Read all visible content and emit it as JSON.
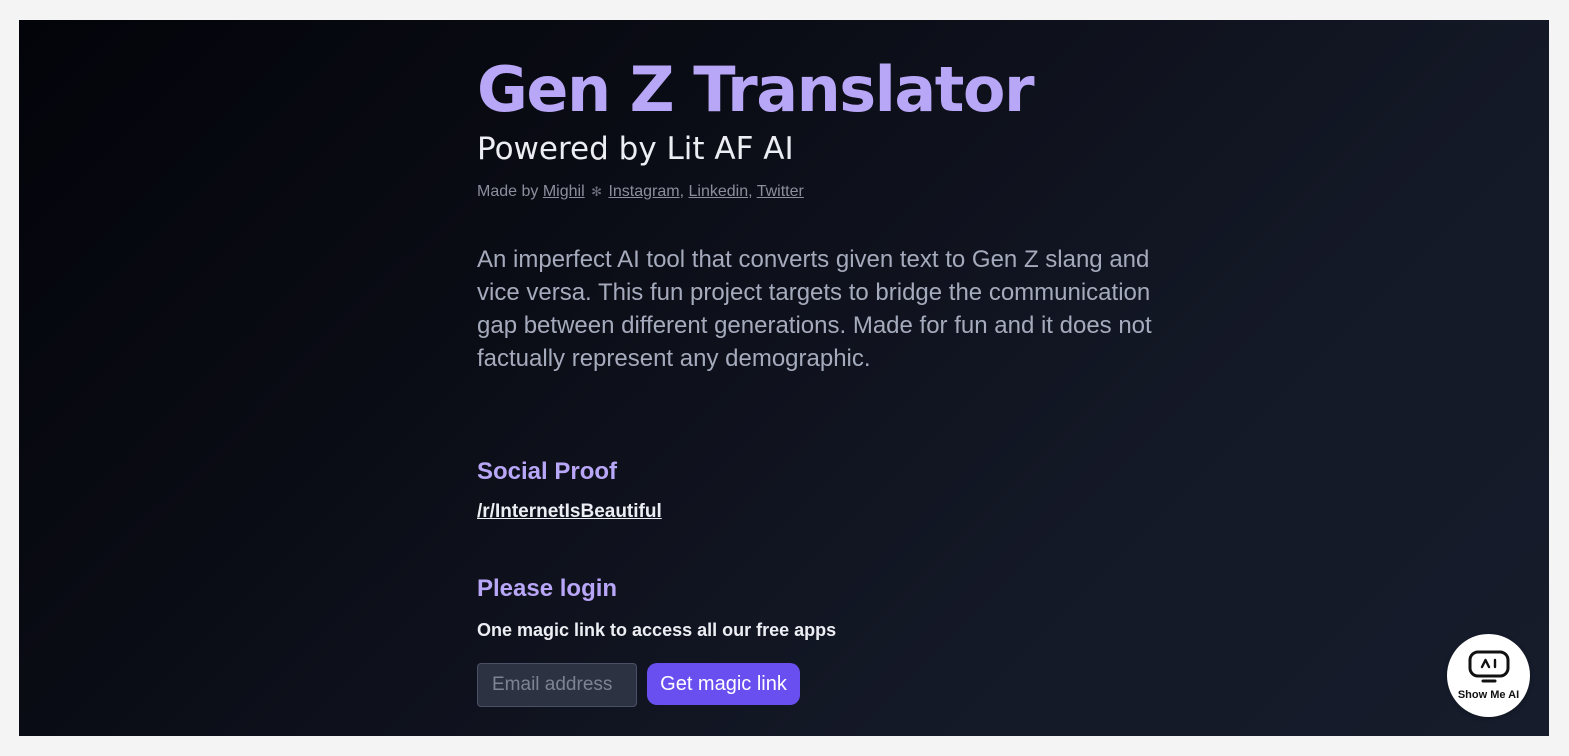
{
  "header": {
    "title": "Gen Z Translator",
    "subtitle": "Powered by Lit AF AI"
  },
  "byline": {
    "prefix": "Made by",
    "author": "Mighil",
    "separator": "✻",
    "links": [
      "Instagram",
      "Linkedin",
      "Twitter"
    ],
    "comma": ","
  },
  "description": "An imperfect AI tool that converts given text to Gen Z slang and vice versa. This fun project targets to bridge the communication gap between different generations. Made for fun and it does not factually represent any demographic.",
  "social_proof": {
    "title": "Social Proof",
    "link": "/r/InternetIsBeautiful"
  },
  "login": {
    "title": "Please login",
    "subtitle": "One magic link to access all our free apps",
    "email_placeholder": "Email address",
    "button_label": "Get magic link"
  },
  "badge": {
    "label": "Show Me AI",
    "icon": "robot-face-icon"
  },
  "colors": {
    "accent": "#b8a6f7",
    "button": "#6a4ff0",
    "text": "#eceef3",
    "muted": "#a5abbc"
  }
}
